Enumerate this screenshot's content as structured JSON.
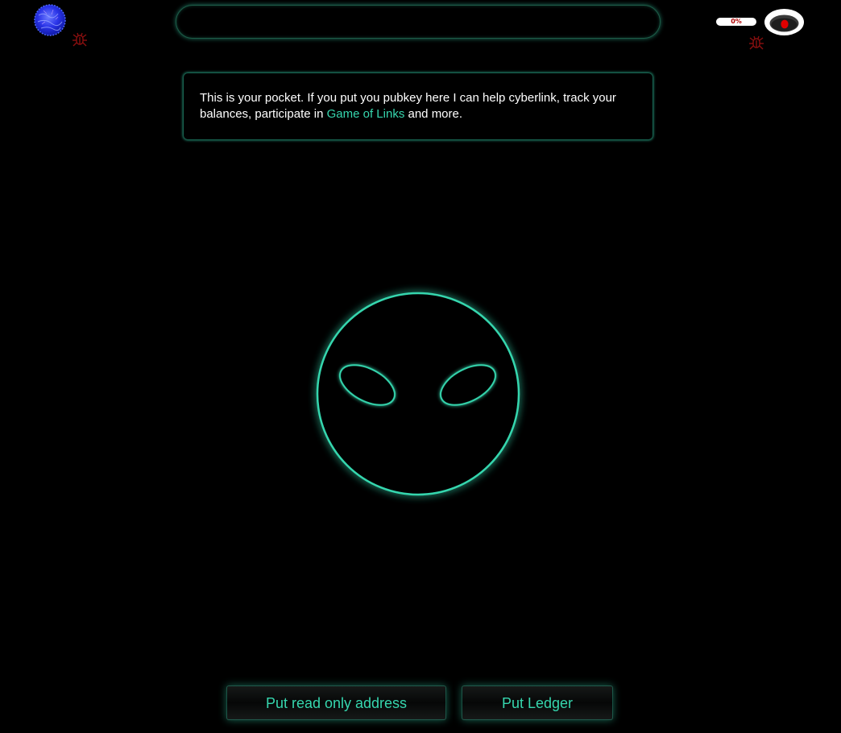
{
  "header": {
    "logo_icon": "planet-logo-icon",
    "bug_icon": "bug-icon",
    "search": {
      "value": "",
      "placeholder": ""
    },
    "battery": {
      "label": "0%",
      "level_percent": 0
    },
    "eye_icon": "eye-icon"
  },
  "info": {
    "text_before": "This is your pocket. If you put you pubkey here I can help cyberlink, track your balances, participate in ",
    "link_text": "Game of Links",
    "text_after": " and more."
  },
  "alien_icon": "alien-face-icon",
  "actions": {
    "read_only_label": "Put read only address",
    "ledger_label": "Put Ledger"
  },
  "colors": {
    "accent": "#36d6ae",
    "background": "#000000",
    "warning": "#b00000"
  }
}
